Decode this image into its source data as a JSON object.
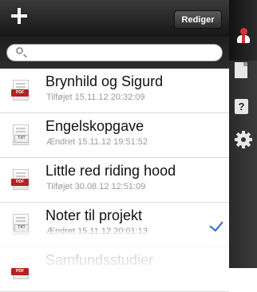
{
  "toolbar": {
    "edit_label": "Rediger",
    "add_icon": "plus-icon"
  },
  "search": {
    "placeholder": "",
    "icon": "search-icon"
  },
  "documents": [
    {
      "title": "Brynhild og Sigurd",
      "subtitle": "Tilføjet 15.11.12 20:32:09",
      "type": "PDF",
      "selected": false
    },
    {
      "title": "Engelskopgave",
      "subtitle": "Ændret 15.11.12 19:51:52",
      "type": "TXT",
      "selected": false
    },
    {
      "title": "Little red riding hood",
      "subtitle": "Tilføjet 30.08.12 12:51:09",
      "type": "PDF",
      "selected": false
    },
    {
      "title": "Noter til projekt",
      "subtitle": "Ændret 15.11.12 20:01:13",
      "type": "TXT",
      "selected": true
    },
    {
      "title": "Samfundsstudier",
      "subtitle": "",
      "type": "PDF",
      "selected": false
    }
  ],
  "sidebar": {
    "icons": [
      "person-icon",
      "file-icon",
      "help-icon",
      "gear-icon"
    ],
    "help_label": "?"
  },
  "colors": {
    "accent": "#2a6ed6",
    "pdf": "#b32222",
    "topbar": "#1f1f1f"
  }
}
